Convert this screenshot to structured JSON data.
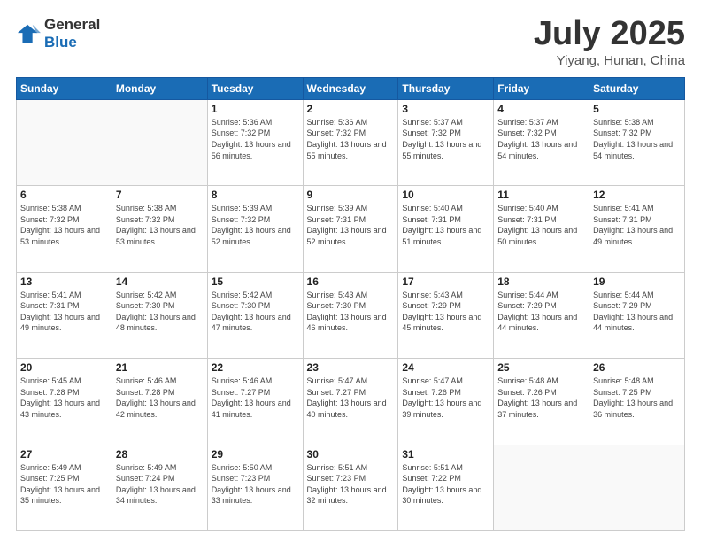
{
  "logo": {
    "general": "General",
    "blue": "Blue"
  },
  "title": "July 2025",
  "subtitle": "Yiyang, Hunan, China",
  "days_of_week": [
    "Sunday",
    "Monday",
    "Tuesday",
    "Wednesday",
    "Thursday",
    "Friday",
    "Saturday"
  ],
  "weeks": [
    [
      {
        "day": "",
        "info": ""
      },
      {
        "day": "",
        "info": ""
      },
      {
        "day": "1",
        "info": "Sunrise: 5:36 AM\nSunset: 7:32 PM\nDaylight: 13 hours and 56 minutes."
      },
      {
        "day": "2",
        "info": "Sunrise: 5:36 AM\nSunset: 7:32 PM\nDaylight: 13 hours and 55 minutes."
      },
      {
        "day": "3",
        "info": "Sunrise: 5:37 AM\nSunset: 7:32 PM\nDaylight: 13 hours and 55 minutes."
      },
      {
        "day": "4",
        "info": "Sunrise: 5:37 AM\nSunset: 7:32 PM\nDaylight: 13 hours and 54 minutes."
      },
      {
        "day": "5",
        "info": "Sunrise: 5:38 AM\nSunset: 7:32 PM\nDaylight: 13 hours and 54 minutes."
      }
    ],
    [
      {
        "day": "6",
        "info": "Sunrise: 5:38 AM\nSunset: 7:32 PM\nDaylight: 13 hours and 53 minutes."
      },
      {
        "day": "7",
        "info": "Sunrise: 5:38 AM\nSunset: 7:32 PM\nDaylight: 13 hours and 53 minutes."
      },
      {
        "day": "8",
        "info": "Sunrise: 5:39 AM\nSunset: 7:32 PM\nDaylight: 13 hours and 52 minutes."
      },
      {
        "day": "9",
        "info": "Sunrise: 5:39 AM\nSunset: 7:31 PM\nDaylight: 13 hours and 52 minutes."
      },
      {
        "day": "10",
        "info": "Sunrise: 5:40 AM\nSunset: 7:31 PM\nDaylight: 13 hours and 51 minutes."
      },
      {
        "day": "11",
        "info": "Sunrise: 5:40 AM\nSunset: 7:31 PM\nDaylight: 13 hours and 50 minutes."
      },
      {
        "day": "12",
        "info": "Sunrise: 5:41 AM\nSunset: 7:31 PM\nDaylight: 13 hours and 49 minutes."
      }
    ],
    [
      {
        "day": "13",
        "info": "Sunrise: 5:41 AM\nSunset: 7:31 PM\nDaylight: 13 hours and 49 minutes."
      },
      {
        "day": "14",
        "info": "Sunrise: 5:42 AM\nSunset: 7:30 PM\nDaylight: 13 hours and 48 minutes."
      },
      {
        "day": "15",
        "info": "Sunrise: 5:42 AM\nSunset: 7:30 PM\nDaylight: 13 hours and 47 minutes."
      },
      {
        "day": "16",
        "info": "Sunrise: 5:43 AM\nSunset: 7:30 PM\nDaylight: 13 hours and 46 minutes."
      },
      {
        "day": "17",
        "info": "Sunrise: 5:43 AM\nSunset: 7:29 PM\nDaylight: 13 hours and 45 minutes."
      },
      {
        "day": "18",
        "info": "Sunrise: 5:44 AM\nSunset: 7:29 PM\nDaylight: 13 hours and 44 minutes."
      },
      {
        "day": "19",
        "info": "Sunrise: 5:44 AM\nSunset: 7:29 PM\nDaylight: 13 hours and 44 minutes."
      }
    ],
    [
      {
        "day": "20",
        "info": "Sunrise: 5:45 AM\nSunset: 7:28 PM\nDaylight: 13 hours and 43 minutes."
      },
      {
        "day": "21",
        "info": "Sunrise: 5:46 AM\nSunset: 7:28 PM\nDaylight: 13 hours and 42 minutes."
      },
      {
        "day": "22",
        "info": "Sunrise: 5:46 AM\nSunset: 7:27 PM\nDaylight: 13 hours and 41 minutes."
      },
      {
        "day": "23",
        "info": "Sunrise: 5:47 AM\nSunset: 7:27 PM\nDaylight: 13 hours and 40 minutes."
      },
      {
        "day": "24",
        "info": "Sunrise: 5:47 AM\nSunset: 7:26 PM\nDaylight: 13 hours and 39 minutes."
      },
      {
        "day": "25",
        "info": "Sunrise: 5:48 AM\nSunset: 7:26 PM\nDaylight: 13 hours and 37 minutes."
      },
      {
        "day": "26",
        "info": "Sunrise: 5:48 AM\nSunset: 7:25 PM\nDaylight: 13 hours and 36 minutes."
      }
    ],
    [
      {
        "day": "27",
        "info": "Sunrise: 5:49 AM\nSunset: 7:25 PM\nDaylight: 13 hours and 35 minutes."
      },
      {
        "day": "28",
        "info": "Sunrise: 5:49 AM\nSunset: 7:24 PM\nDaylight: 13 hours and 34 minutes."
      },
      {
        "day": "29",
        "info": "Sunrise: 5:50 AM\nSunset: 7:23 PM\nDaylight: 13 hours and 33 minutes."
      },
      {
        "day": "30",
        "info": "Sunrise: 5:51 AM\nSunset: 7:23 PM\nDaylight: 13 hours and 32 minutes."
      },
      {
        "day": "31",
        "info": "Sunrise: 5:51 AM\nSunset: 7:22 PM\nDaylight: 13 hours and 30 minutes."
      },
      {
        "day": "",
        "info": ""
      },
      {
        "day": "",
        "info": ""
      }
    ]
  ]
}
